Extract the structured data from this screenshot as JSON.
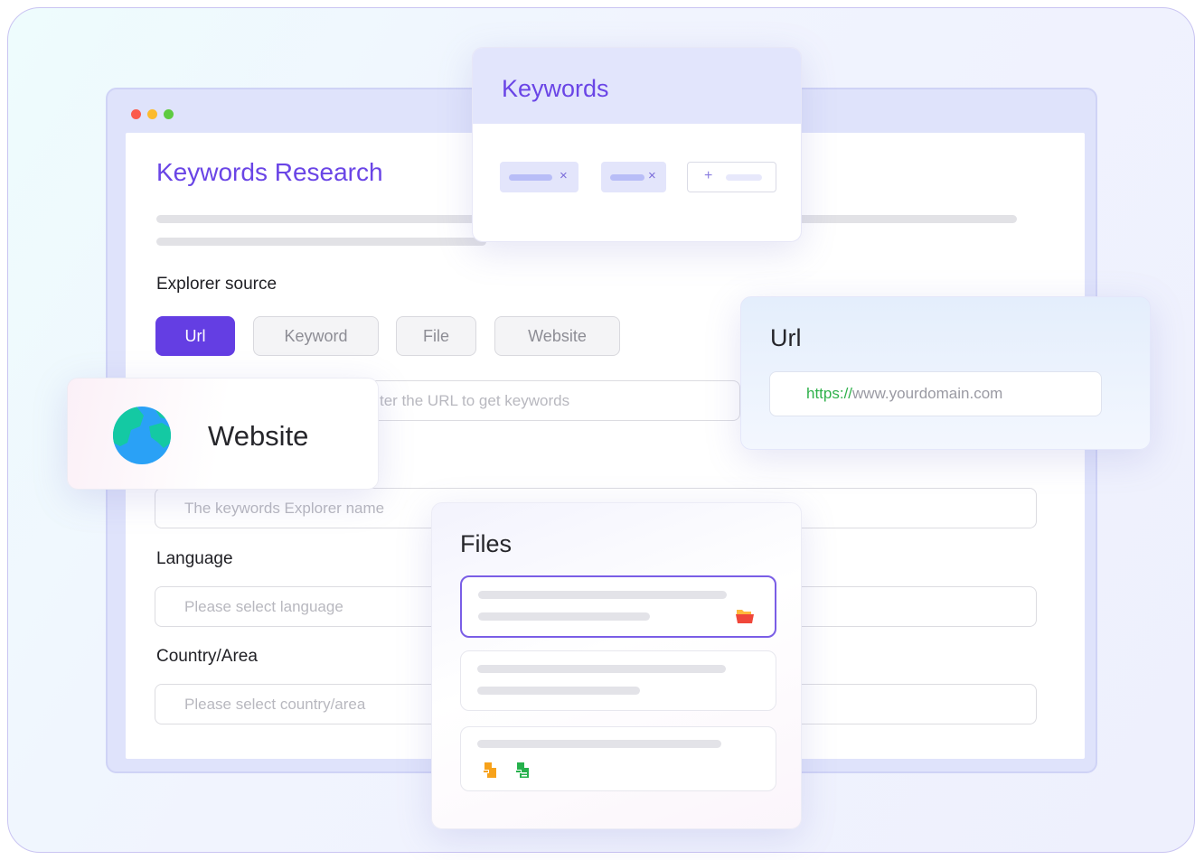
{
  "window": {
    "title": "Keywords Research",
    "explorer_source_label": "Explorer source",
    "sources": [
      {
        "label": "Url",
        "active": true
      },
      {
        "label": "Keyword",
        "active": false
      },
      {
        "label": "File",
        "active": false
      },
      {
        "label": "Website",
        "active": false
      }
    ],
    "url_placeholder": "ter the URL to get keywords",
    "name_placeholder": "The keywords Explorer name",
    "language_label": "Language",
    "language_placeholder": "Please select language",
    "country_label": "Country/Area",
    "country_placeholder": "Please select country/area"
  },
  "keywords_card": {
    "title": "Keywords",
    "remove_symbol": "×",
    "add_symbol": "+"
  },
  "website_card": {
    "label": "Website",
    "icon": "globe-icon"
  },
  "url_card": {
    "title": "Url",
    "protocol": "https://",
    "domain": "www.yourdomain.com"
  },
  "files_card": {
    "title": "Files",
    "icons": [
      "folder-icon",
      "document-icon",
      "spreadsheet-icon"
    ]
  },
  "colors": {
    "accent": "#643ee3",
    "title_purple": "#6a45e6",
    "green": "#2fb14b"
  }
}
